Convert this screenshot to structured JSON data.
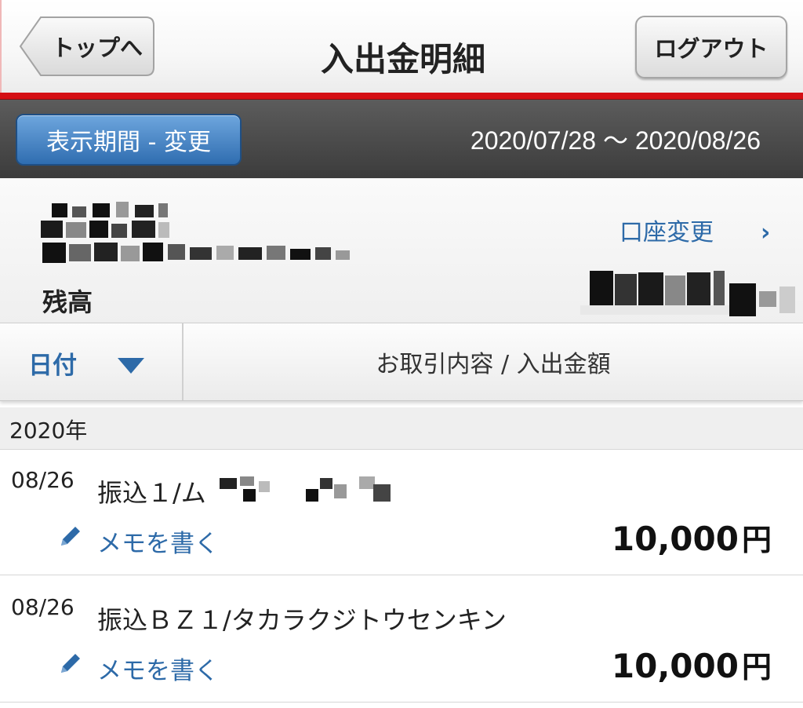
{
  "navbar": {
    "back_label": "トップへ",
    "title": "入出金明細",
    "logout_label": "ログアウト"
  },
  "period": {
    "change_label": "表示期間 - 変更",
    "range": "2020/07/28 ～ 2020/08/26"
  },
  "account": {
    "balance_label": "残高",
    "change_label": "口座変更",
    "change_chevron": "›"
  },
  "list_header": {
    "date_label": "日付",
    "content_label": "お取引内容 / 入出金額"
  },
  "year_label": "2020年",
  "transactions": [
    {
      "date": "08/26",
      "description": "振込１/ム",
      "memo_label": "メモを書く",
      "amount": "10,000",
      "currency": "円"
    },
    {
      "date": "08/26",
      "description": "振込ＢＺ１/タカラクジトウセンキン",
      "memo_label": "メモを書く",
      "amount": "10,000",
      "currency": "円"
    }
  ],
  "colors": {
    "accent_red": "#d40f14",
    "link_blue": "#2d6aa8",
    "button_blue": "#2f6db0",
    "period_bar": "#4a4a4a"
  }
}
